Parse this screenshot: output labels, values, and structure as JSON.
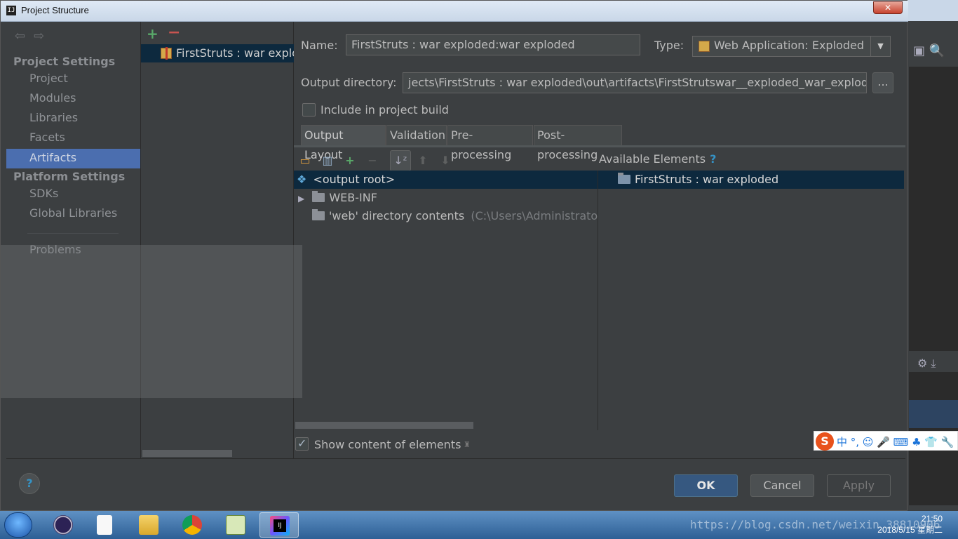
{
  "window": {
    "title": "Project Structure",
    "close_label": "✕"
  },
  "nav": {
    "project_settings_header": "Project Settings",
    "project_settings_items": [
      "Project",
      "Modules",
      "Libraries",
      "Facets",
      "Artifacts"
    ],
    "platform_settings_header": "Platform Settings",
    "platform_settings_items": [
      "SDKs",
      "Global Libraries"
    ],
    "problems": "Problems",
    "active": "Artifacts"
  },
  "artifacts": {
    "items": [
      "FirstStruts : war  exploded"
    ]
  },
  "form": {
    "name_label": "Name:",
    "name_value": "FirstStruts : war  exploded:war exploded",
    "type_label": "Type:",
    "type_value": "Web Application: Exploded",
    "output_dir_label": "Output directory:",
    "output_dir_value": "jects\\FirstStruts : war  exploded\\out\\artifacts\\FirstStrutswar__exploded_war_exploded",
    "browse_label": "...",
    "include_build_label": "Include in project build",
    "include_build_checked": false
  },
  "tabs": [
    "Output Layout",
    "Validation",
    "Pre-processing",
    "Post-processing"
  ],
  "active_tab": "Output Layout",
  "layout": {
    "available_elements_label": "Available Elements",
    "help_mark": "?",
    "tree": [
      {
        "label": "<output root>",
        "selected": true
      },
      {
        "label": "WEB-INF",
        "expandable": true
      },
      {
        "label": "'web' directory contents",
        "hint": "(C:\\Users\\Administrator\\Ic"
      }
    ],
    "available": [
      {
        "label": "FirstStruts : war  exploded"
      }
    ],
    "show_content_label": "Show content of elements",
    "show_content_checked": true
  },
  "buttons": {
    "ok": "OK",
    "cancel": "Cancel",
    "apply": "Apply",
    "help": "?"
  },
  "ime": {
    "logo": "S",
    "chars": "中 °, ☺ 🎤 ⌨ ♣ 👕 🔧"
  },
  "taskbar": {
    "watermark": "https://blog.csdn.net/weixin_38810906",
    "time": "21:50",
    "date": "2018/5/15 星期二"
  },
  "colors": {
    "accent": "#4b6eaf",
    "selection": "#0d293e",
    "background": "#3c3f41",
    "ok": "#365880"
  }
}
